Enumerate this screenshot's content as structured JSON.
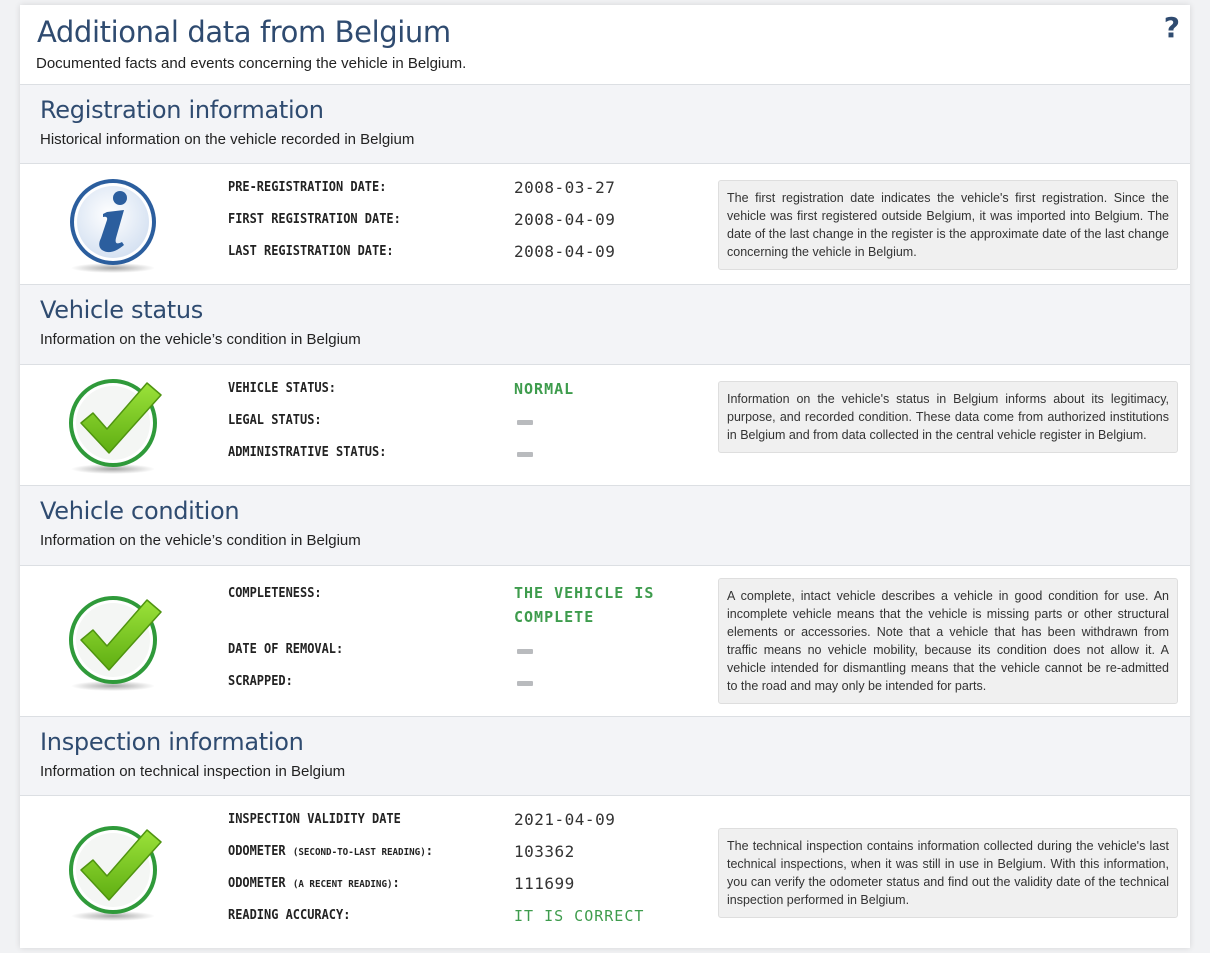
{
  "header": {
    "title": "Additional data from Belgium",
    "subtitle": "Documented facts and events concerning the vehicle in Belgium.",
    "help_icon": "?"
  },
  "registration": {
    "title": "Registration information",
    "subtitle": "Historical information on the vehicle recorded in Belgium",
    "icon": "info-icon",
    "rows": [
      {
        "label": "PRE-REGISTRATION DATE:",
        "value": "2008-03-27"
      },
      {
        "label": "FIRST REGISTRATION DATE:",
        "value": "2008-04-09"
      },
      {
        "label": "LAST REGISTRATION DATE:",
        "value": "2008-04-09"
      }
    ],
    "note": "The first registration date indicates the vehicle's first registration. Since the vehicle was first registered outside Belgium, it was imported into Belgium. The date of the last change in the register is the approximate date of the last change concerning the vehicle in Belgium."
  },
  "status": {
    "title": "Vehicle status",
    "subtitle": "Information on the vehicle’s condition in Belgium",
    "icon": "checkmark-icon",
    "rows": [
      {
        "label": "VEHICLE STATUS:",
        "value": "NORMAL"
      },
      {
        "label": "LEGAL STATUS:",
        "value": ""
      },
      {
        "label": "ADMINISTRATIVE STATUS:",
        "value": ""
      }
    ],
    "note": "Information on the vehicle's status in Belgium informs about its legitimacy, purpose, and recorded condition. These data come from authorized institutions in Belgium and from data collected in the central vehicle register in Belgium."
  },
  "condition": {
    "title": "Vehicle condition",
    "subtitle": "Information on the vehicle’s condition in Belgium",
    "icon": "checkmark-icon",
    "rows": [
      {
        "label": "COMPLETENESS:",
        "value_line1": "THE VEHICLE IS",
        "value_line2": "COMPLETE"
      },
      {
        "label": "DATE OF REMOVAL:",
        "value": ""
      },
      {
        "label": "SCRAPPED:",
        "value": ""
      }
    ],
    "note": "A complete, intact vehicle describes a vehicle in good condition for use. An incomplete vehicle means that the vehicle is missing parts or other structural elements or accessories. Note that a vehicle that has been withdrawn from traffic means no vehicle mobility, because its condition does not allow it. A vehicle intended for dismantling means that the vehicle cannot be re-admitted to the road and may only be intended for parts."
  },
  "inspection": {
    "title": "Inspection information",
    "subtitle": "Information on technical inspection in Belgium",
    "icon": "checkmark-icon",
    "rows": [
      {
        "label": "INSPECTION VALIDITY DATE",
        "value": "2021-04-09"
      },
      {
        "label": "ODOMETER",
        "label_small": "(SECOND-TO-LAST READING)",
        "label_suffix": ":",
        "value": "103362"
      },
      {
        "label": "ODOMETER",
        "label_small": "(A RECENT READING)",
        "label_suffix": ":",
        "value": "111699"
      },
      {
        "label": "READING ACCURACY:",
        "value": "IT IS CORRECT"
      }
    ],
    "note": "The technical inspection contains information collected during the vehicle's last technical inspections, when it was still in use in Belgium. With this information, you can verify the odometer status and find out the validity date of the technical inspection performed in Belgium."
  },
  "colors": {
    "heading": "#2f4b70",
    "value_ok": "#3e9c4d",
    "section_bg": "#f3f4f7",
    "check_green": "#7dc31a",
    "info_blue": "#2b5e9e"
  }
}
